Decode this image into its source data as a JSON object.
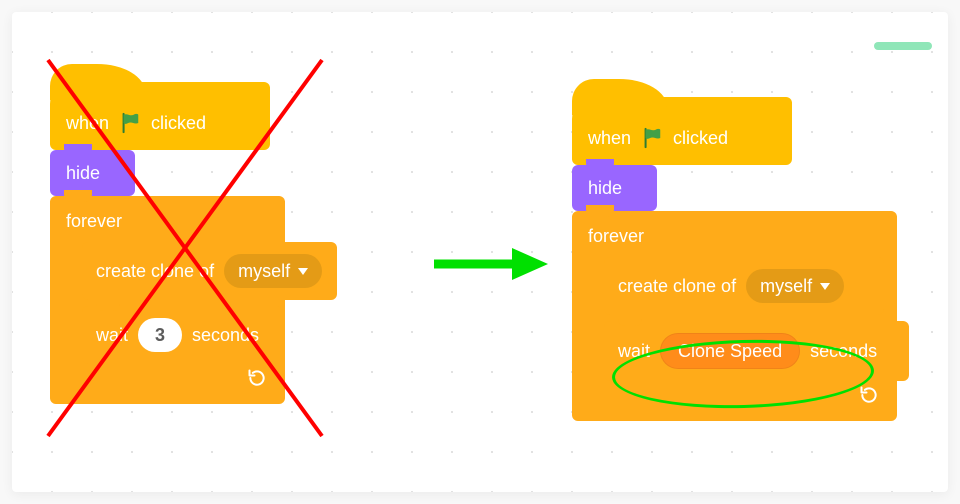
{
  "hat": {
    "prefix": "when",
    "suffix": "clicked"
  },
  "looks": {
    "hide": "hide"
  },
  "control": {
    "forever": "forever",
    "create_clone": "create clone of",
    "myself": "myself",
    "wait": "wait",
    "seconds": "seconds"
  },
  "left": {
    "wait_value": "3"
  },
  "right": {
    "wait_var": "Clone Speed"
  },
  "icons": {
    "flag": "green-flag-icon",
    "loop": "repeat-icon",
    "caret": "dropdown-caret-icon",
    "arrow": "transform-arrow-icon",
    "cross": "red-cross-icon",
    "circle": "green-highlight-icon"
  }
}
